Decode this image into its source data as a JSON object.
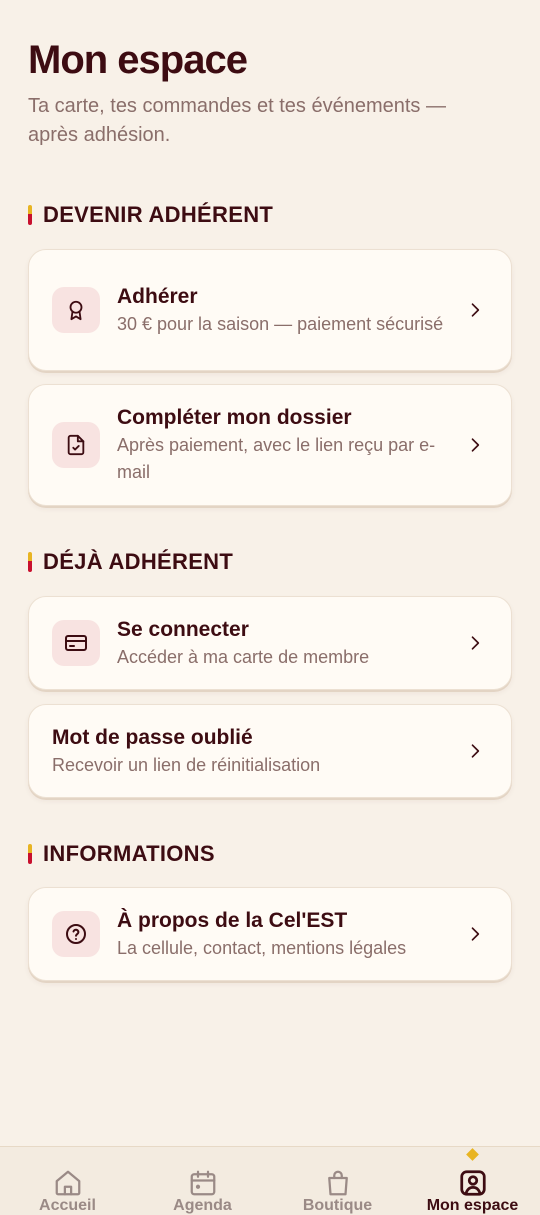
{
  "header": {
    "title": "Mon espace",
    "subtitle": "Ta carte, tes commandes et tes événements — après adhésion."
  },
  "sections": [
    {
      "heading": "DEVENIR ADHÉRENT",
      "items": [
        {
          "title": "Adhérer",
          "desc": "30 € pour la saison — paiement sécurisé",
          "icon": "award-icon"
        },
        {
          "title": "Compléter mon dossier",
          "desc": "Après paiement, avec le lien reçu par e-mail",
          "icon": "file-check-icon"
        }
      ]
    },
    {
      "heading": "DÉJÀ ADHÉRENT",
      "items": [
        {
          "title": "Se connecter",
          "desc": "Accéder à ma carte de membre",
          "icon": "id-card-icon"
        },
        {
          "title": "Mot de passe oublié",
          "desc": "Recevoir un lien de réinitialisation",
          "icon": null
        }
      ]
    },
    {
      "heading": "INFORMATIONS",
      "items": [
        {
          "title": "À propos de la Cel'EST",
          "desc": "La cellule, contact, mentions légales",
          "icon": "help-circle-icon"
        }
      ]
    }
  ],
  "tabbar": {
    "tabs": [
      {
        "label": "Accueil",
        "icon": "home-icon",
        "active": false
      },
      {
        "label": "Agenda",
        "icon": "calendar-icon",
        "active": false
      },
      {
        "label": "Boutique",
        "icon": "shopping-bag-icon",
        "active": false
      },
      {
        "label": "Mon espace",
        "icon": "user-square-icon",
        "active": true
      }
    ]
  },
  "colors": {
    "background": "#f8f1e8",
    "primary_text": "#3d0c12",
    "muted_text": "#8a6e6a",
    "icon_tint_bg": "#f8e3e1",
    "accent_yellow": "#e8b422",
    "accent_red": "#c8102e"
  }
}
